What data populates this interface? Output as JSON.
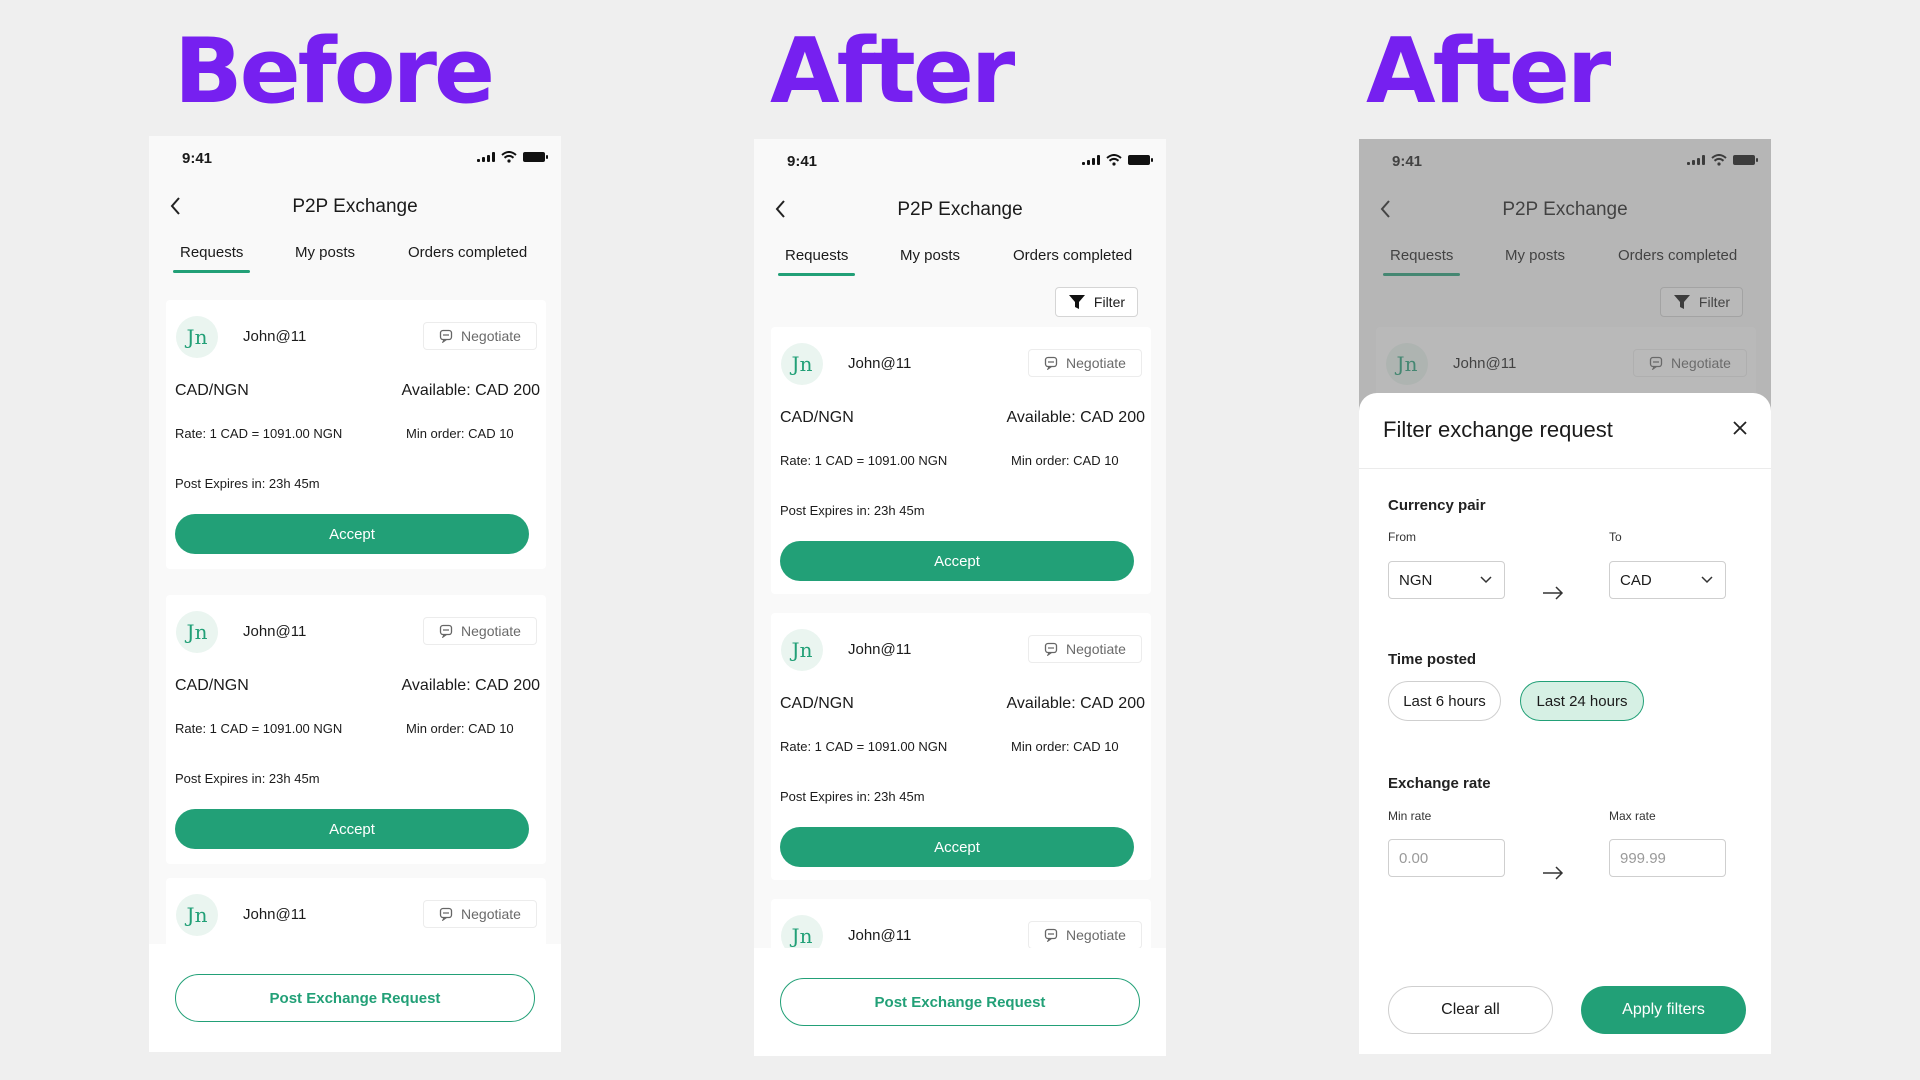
{
  "headlines": {
    "before": "Before",
    "after1": "After",
    "after2": "After"
  },
  "status": {
    "time": "9:41"
  },
  "app": {
    "title": "P2P Exchange"
  },
  "tabs": [
    "Requests",
    "My posts",
    "Orders completed"
  ],
  "filter_label": "Filter",
  "card": {
    "avatar": "Jn",
    "user": "John@11",
    "negotiate": "Negotiate",
    "pair": "CAD/NGN",
    "available": "Available: CAD 200",
    "rate": "Rate: 1 CAD = 1091.00 NGN",
    "min_order": "Min order: CAD 10",
    "expires": "Post Expires in: 23h 45m",
    "accept": "Accept"
  },
  "post_button": "Post Exchange Request",
  "filter_sheet": {
    "title": "Filter exchange request",
    "currency_pair": "Currency pair",
    "from_label": "From",
    "to_label": "To",
    "from_value": "NGN",
    "to_value": "CAD",
    "time_posted": "Time posted",
    "chips": [
      "Last 6 hours",
      "Last 24 hours"
    ],
    "selected_chip": "Last 24 hours",
    "exchange_rate": "Exchange rate",
    "min_rate_label": "Min rate",
    "max_rate_label": "Max rate",
    "min_rate_placeholder": "0.00",
    "max_rate_placeholder": "999.99",
    "clear": "Clear all",
    "apply": "Apply filters"
  },
  "colors": {
    "accent": "#22a077",
    "headline": "#7620f0",
    "chip_selected_bg": "#d6f0e4"
  }
}
